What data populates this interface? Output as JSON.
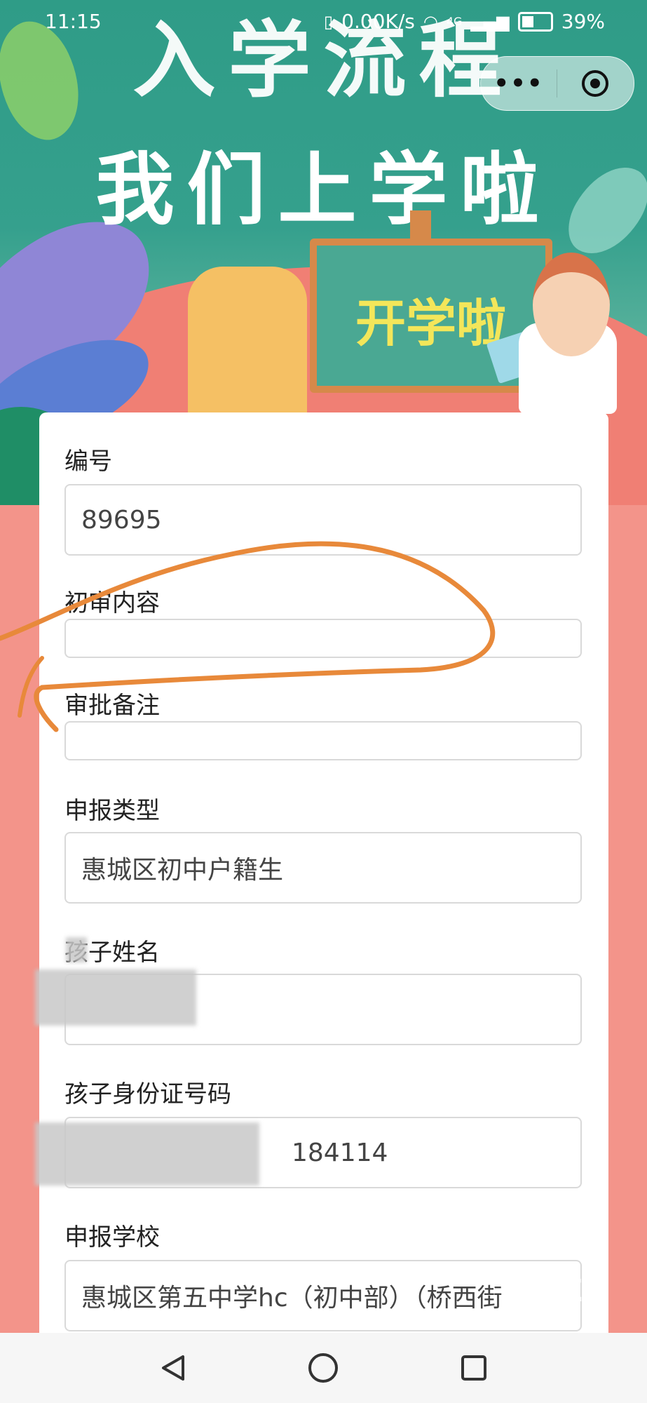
{
  "status_bar": {
    "time": "11:15",
    "net_speed": "0.00K/s",
    "network": "4G",
    "battery": "39%"
  },
  "banner": {
    "line1": "入学流程",
    "line2": "我们上学啦",
    "board_text": "开学啦"
  },
  "capsule": {
    "more_icon": "more-icon",
    "close_icon": "close-icon"
  },
  "form": {
    "fields": [
      {
        "label": "编号",
        "value": "89695"
      },
      {
        "label": "初审内容",
        "value": ""
      },
      {
        "label": "审批备注",
        "value": ""
      },
      {
        "label": "申报类型",
        "value": "惠城区初中户籍生"
      },
      {
        "label": "孩子姓名",
        "value": ""
      },
      {
        "label": "孩子身份证号码",
        "value": "184114"
      },
      {
        "label": "申报学校",
        "value": "惠城区第五中学hc（初中部）（桥西街"
      }
    ]
  },
  "watermark": "XIZI",
  "colors": {
    "banner_green": "#2f9c87",
    "page_pink": "#f3948a",
    "scribble_orange": "#e8893a",
    "board_text_yellow": "#f3e65a"
  },
  "nav": {
    "back_icon": "back-triangle-icon",
    "home_icon": "home-circle-icon",
    "recent_icon": "recent-square-icon"
  }
}
